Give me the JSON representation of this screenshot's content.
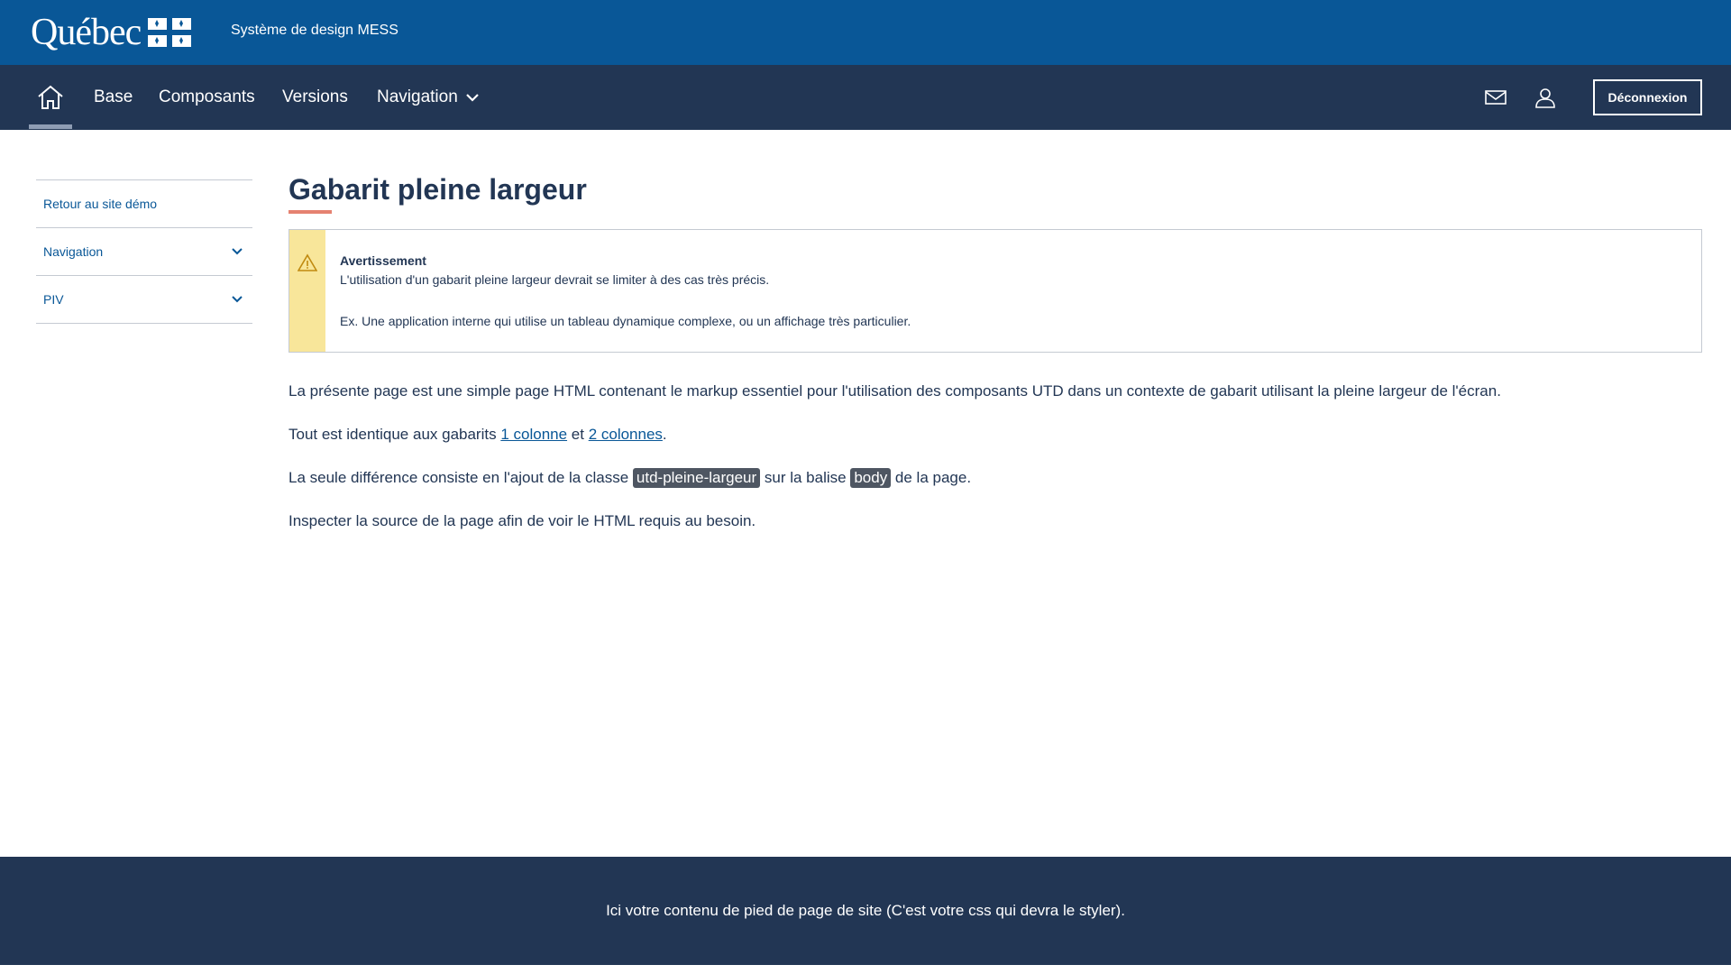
{
  "header": {
    "logo_text": "Québec",
    "site_title": "Système de design MESS",
    "colors": {
      "banner": "#095797",
      "nav": "#223654"
    }
  },
  "nav": {
    "home_icon": "home-icon",
    "items": [
      {
        "label": "Base"
      },
      {
        "label": "Composants"
      },
      {
        "label": "Versions"
      },
      {
        "label": "Navigation"
      }
    ],
    "mail_icon": "mail-icon",
    "user_icon": "user-icon",
    "logout_label": "Déconnexion"
  },
  "sidebar": {
    "items": [
      {
        "label": "Retour au site démo"
      },
      {
        "label": "Navigation"
      },
      {
        "label": "PIV"
      }
    ]
  },
  "main": {
    "title": "Gabarit pleine largeur",
    "alert": {
      "title": "Avertissement",
      "line1": "L'utilisation d'un gabarit pleine largeur devrait se limiter à des cas très précis.",
      "line2": "Ex. Une application interne qui utilise un tableau dynamique complexe, ou un affichage très particulier.",
      "color": "#f8e69a"
    },
    "p1": "La présente page est une simple page HTML contenant le markup essentiel pour l'utilisation des composants UTD dans un contexte de gabarit utilisant la pleine largeur de l'écran.",
    "p2": {
      "before": "Tout est identique aux gabarits ",
      "link1": "1 colonne",
      "between": " et ",
      "link2": "2 colonnes",
      "after": "."
    },
    "p3": {
      "before": "La seule différence consiste en l'ajout de la classe ",
      "code1": "utd-pleine-largeur",
      "between": " sur la balise ",
      "code2": "body",
      "after": " de la page."
    },
    "p4": "Inspecter la source de la page afin de voir le HTML requis au besoin."
  },
  "footer": {
    "text": "Ici votre contenu de pied de page de site (C'est votre css qui devra le styler)."
  }
}
